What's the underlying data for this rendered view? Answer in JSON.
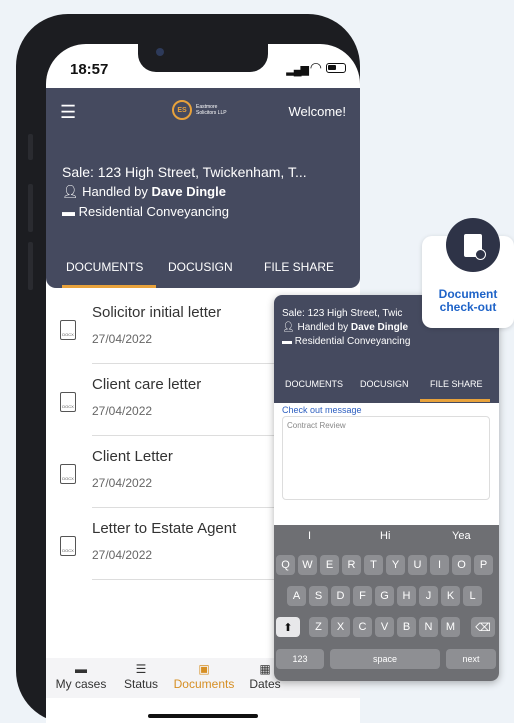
{
  "status": {
    "time": "18:57"
  },
  "header": {
    "logo_initials": "ES",
    "logo_text": "Eastmore Solicitors LLP",
    "welcome": "Welcome!",
    "case_title": "Sale: 123 High Street, Twickenham, T...",
    "handled_prefix": "Handled by",
    "handler": "Dave Dingle",
    "case_type": "Residential Conveyancing"
  },
  "tabs": [
    "DOCUMENTS",
    "DOCUSIGN",
    "FILE SHARE"
  ],
  "documents": [
    {
      "name": "Solicitor initial letter",
      "date": "27/04/2022"
    },
    {
      "name": "Client care letter",
      "date": "27/04/2022"
    },
    {
      "name": "Client Letter",
      "date": "27/04/2022"
    },
    {
      "name": "Letter to Estate Agent",
      "date": "27/04/2022"
    }
  ],
  "doc_icon_label": "DOCX",
  "nav": [
    "My cases",
    "Status",
    "Documents",
    "Dates"
  ],
  "overlay": {
    "case_title": "Sale: 123 High Street, Twic",
    "handled_prefix": "Handled by",
    "handler": "Dave Dingle",
    "case_type": "Residential Conveyancing",
    "tabs": [
      "DOCUMENTS",
      "DOCUSIGN",
      "FILE SHARE"
    ],
    "checkout_label": "Check out message",
    "checkout_value": "Contract Review",
    "suggestions": [
      "I",
      "Hi",
      "Yea"
    ],
    "keys_row1": [
      "Q",
      "W",
      "E",
      "R",
      "T",
      "Y",
      "U",
      "I",
      "O",
      "P"
    ],
    "keys_row2": [
      "A",
      "S",
      "D",
      "F",
      "G",
      "H",
      "J",
      "K",
      "L"
    ],
    "keys_row3": [
      "Z",
      "X",
      "C",
      "V",
      "B",
      "N",
      "M"
    ],
    "key_123": "123",
    "key_space": "space",
    "key_next": "next"
  },
  "badge": {
    "label": "Document check-out"
  },
  "colors": {
    "header_bg": "#454a5f",
    "accent": "#e8a23b",
    "link": "#1e63c8"
  }
}
